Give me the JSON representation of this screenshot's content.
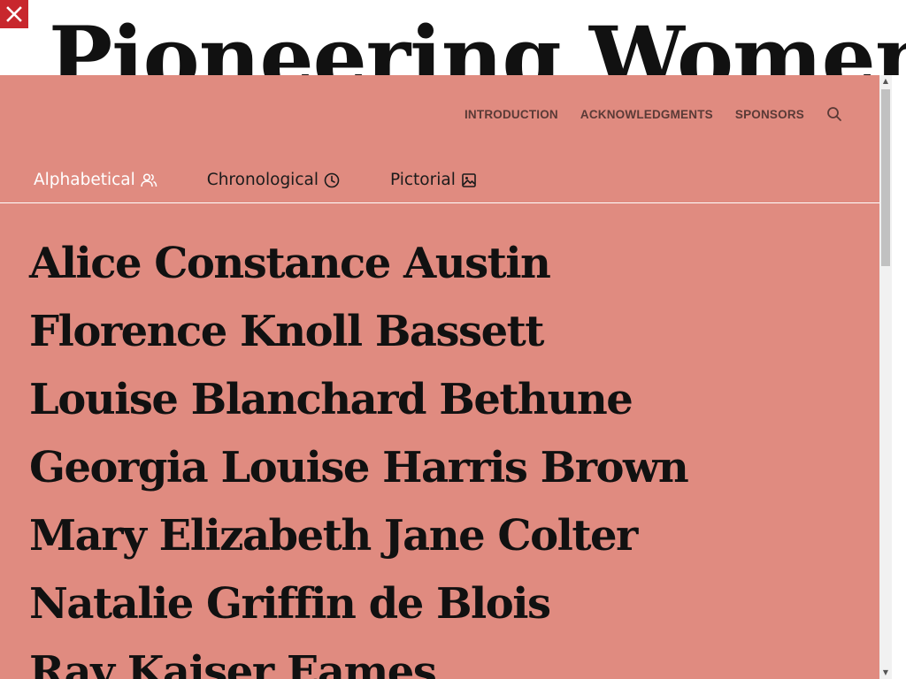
{
  "page": {
    "title": "Pioneering Women"
  },
  "close": {
    "icon": "close-icon"
  },
  "nav": {
    "links": [
      "INTRODUCTION",
      "ACKNOWLEDGMENTS",
      "SPONSORS"
    ],
    "search_icon": "search-icon"
  },
  "tabs": [
    {
      "label": "Alphabetical",
      "icon": "people-icon",
      "active": true
    },
    {
      "label": "Chronological",
      "icon": "clock-icon",
      "active": false
    },
    {
      "label": "Pictorial",
      "icon": "image-icon",
      "active": false
    }
  ],
  "names": [
    "Alice Constance Austin",
    "Florence Knoll Bassett",
    "Louise Blanchard Bethune",
    "Georgia Louise Harris Brown",
    "Mary Elizabeth Jane Colter",
    "Natalie Griffin de Blois",
    "Ray Kaiser Eames"
  ],
  "colors": {
    "overlay_bg": "#e08b80",
    "close_bg": "#c8272d",
    "active_tab": "#ffffff",
    "nav_text": "#5a3a36"
  }
}
